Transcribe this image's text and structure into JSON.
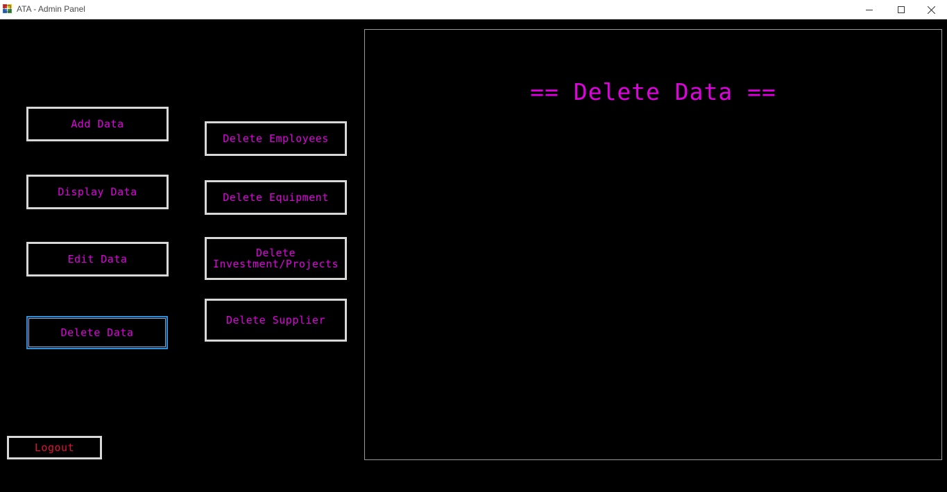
{
  "window": {
    "title": "ATA - Admin Panel"
  },
  "icons": {
    "app": "app-icon",
    "minimize": "minimize-icon",
    "maximize": "maximize-icon",
    "close": "close-icon"
  },
  "nav": {
    "add": "Add Data",
    "display": "Display Data",
    "edit": "Edit Data",
    "delete": "Delete Data",
    "logout": "Logout"
  },
  "submenu": {
    "employees": "Delete Employees",
    "equipment": "Delete Equipment",
    "investment_line1": "Delete",
    "investment_line2": "Investment/Projects",
    "supplier": "Delete Supplier"
  },
  "panel": {
    "heading": "== Delete Data =="
  },
  "colors": {
    "background": "#000000",
    "button_text": "#e000e0",
    "logout_text": "#e0103a",
    "button_border": "#d8d8d8",
    "active_border": "#2f8fd6"
  }
}
